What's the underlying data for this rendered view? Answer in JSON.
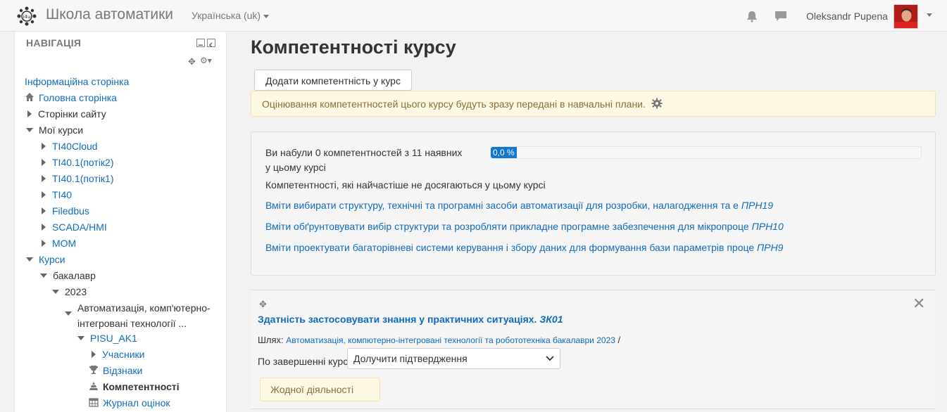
{
  "header": {
    "site_name": "Школа автоматики",
    "language": "Українська (uk)",
    "user_name": "Oleksandr Pupena"
  },
  "navigation": {
    "title": "НАВІГАЦІЯ",
    "items": [
      {
        "label": "Інформаційна сторінка"
      },
      {
        "label": "Головна сторінка"
      },
      {
        "label": "Сторінки сайту"
      },
      {
        "label": "Мої курси"
      },
      {
        "label": "TI40Cloud"
      },
      {
        "label": "TI40.1(потік2)"
      },
      {
        "label": "TI40.1(потік1)"
      },
      {
        "label": "TI40"
      },
      {
        "label": "Filedbus"
      },
      {
        "label": "SCADA/HMI"
      },
      {
        "label": "MOM"
      },
      {
        "label": "Курси"
      },
      {
        "label": "бакалавр"
      },
      {
        "label": "2023"
      },
      {
        "label": "Автоматизація, комп'ютерно-"
      },
      {
        "label": "інтегровані технології ..."
      },
      {
        "label": "PISU_AK1"
      },
      {
        "label": "Учасники"
      },
      {
        "label": "Відзнаки"
      },
      {
        "label": "Компетентності"
      },
      {
        "label": "Журнал оцінок"
      }
    ]
  },
  "main": {
    "title": "Компетентності курсу",
    "add_button": "Додати компетентність у курс",
    "notice": "Оцінювання компетентностей цього курсу будуть зразу передані в навчальні плани.",
    "summary": {
      "progress_line1": "Ви набули 0 компетентностей з 11 наявних",
      "progress_line2": "у цьому курсі",
      "progress_label": "0,0 %",
      "progress_value": 0.0,
      "most_missed_heading": "Компетентності, які найчастіше не досягаються у цьому курсі",
      "links": [
        {
          "text": "Вміти вибирати структуру, технічні та програмні засоби автоматизації для розробки, налагодження та е",
          "code": "ПРН19"
        },
        {
          "text": "Вміти обґрунтовувати вибір структури та розробляти прикладне програмне забезпечення для мікропроце",
          "code": "ПРН10"
        },
        {
          "text": "Вміти проектувати багаторівневі системи керування і збору даних для формування бази параметрів проце",
          "code": "ПРН9"
        }
      ]
    },
    "competency": {
      "title": "Здатність застосовувати знання у практичних ситуаціях.",
      "code": "ЗК01",
      "path_label": "Шлях:",
      "path_link": "Автоматизація, компютерно-інтегровані технології та робототехніка бакалаври 2023",
      "path_sep": "/",
      "completion_label": "По завершенні курсу:",
      "completion_value": "Долучити підтвердження",
      "no_activity": "Жодної діяльності"
    }
  },
  "colors": {
    "link": "#0f6cbf",
    "progress": "#1177d1",
    "notice_bg": "#fcf8e3",
    "notice_text": "#8a6d3b"
  }
}
